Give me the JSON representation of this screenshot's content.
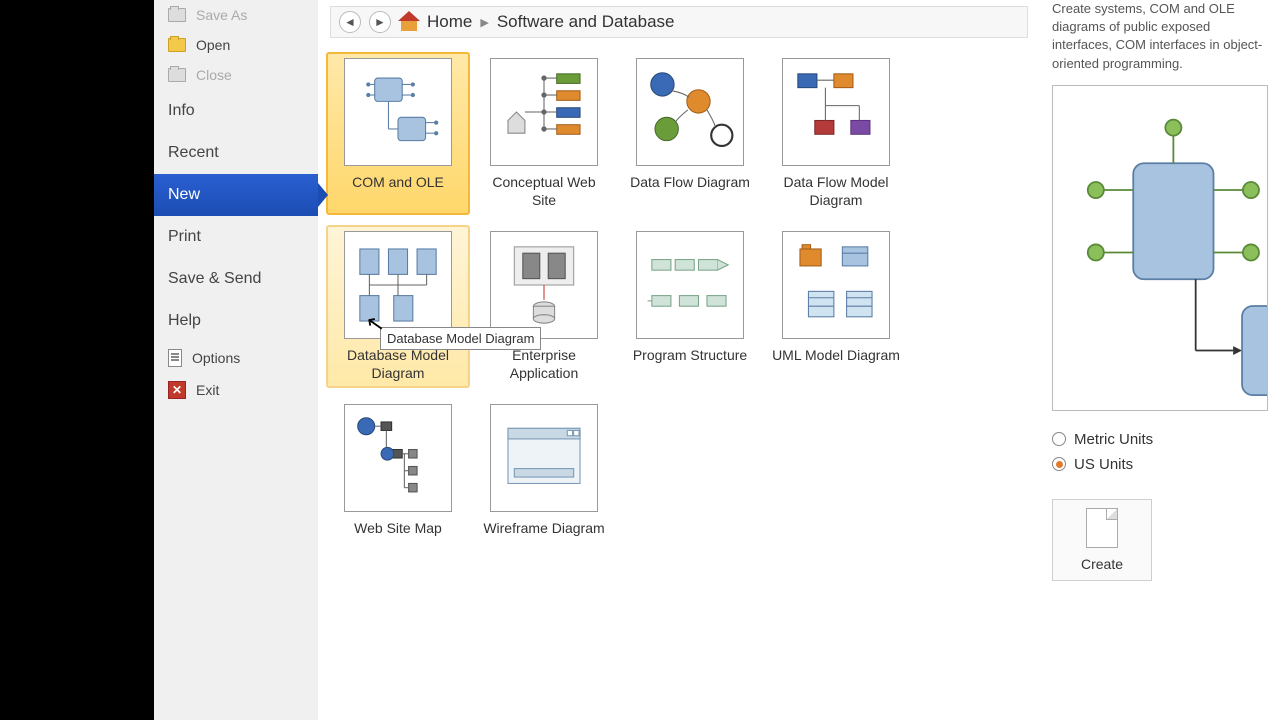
{
  "sidebar": {
    "saveas": "Save As",
    "open": "Open",
    "close": "Close",
    "info": "Info",
    "recent": "Recent",
    "new": "New",
    "print": "Print",
    "savesend": "Save & Send",
    "help": "Help",
    "options": "Options",
    "exit": "Exit"
  },
  "breadcrumb": {
    "home": "Home",
    "category": "Software and Database"
  },
  "templates": [
    {
      "label": "COM and OLE"
    },
    {
      "label": "Conceptual Web Site"
    },
    {
      "label": "Data Flow Diagram"
    },
    {
      "label": "Data Flow Model Diagram"
    },
    {
      "label": "Database Model Diagram"
    },
    {
      "label": "Enterprise Application"
    },
    {
      "label": "Program Structure"
    },
    {
      "label": "UML Model Diagram"
    },
    {
      "label": "Web Site Map"
    },
    {
      "label": "Wireframe Diagram"
    }
  ],
  "tooltip": "Database Model Diagram",
  "description": "Create systems, COM and OLE diagrams of public exposed interfaces, COM interfaces in object-oriented programming.",
  "units": {
    "metric": "Metric Units",
    "us": "US Units"
  },
  "create": "Create"
}
